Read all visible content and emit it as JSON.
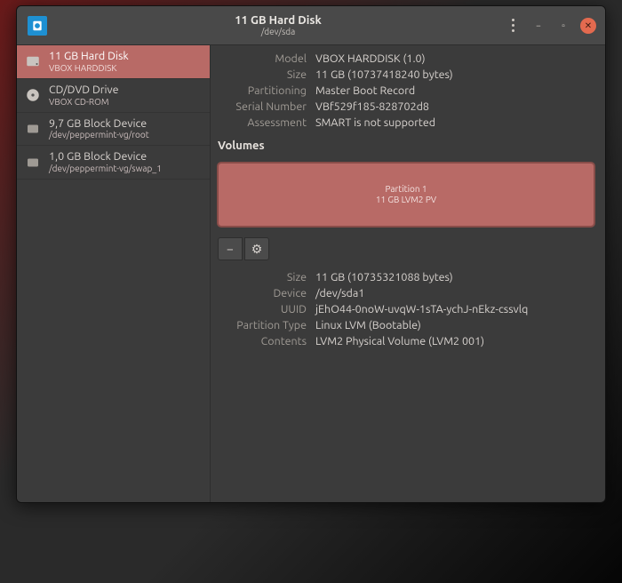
{
  "header": {
    "title": "11 GB Hard Disk",
    "subtitle": "/dev/sda"
  },
  "sidebar": {
    "items": [
      {
        "label": "11 GB Hard Disk",
        "sub": "VBOX HARDDISK",
        "icon": "hdd"
      },
      {
        "label": "CD/DVD Drive",
        "sub": "VBOX CD-ROM",
        "icon": "cd"
      },
      {
        "label": "9,7 GB Block Device",
        "sub": "/dev/peppermint-vg/root",
        "icon": "block"
      },
      {
        "label": "1,0 GB Block Device",
        "sub": "/dev/peppermint-vg/swap_1",
        "icon": "block"
      }
    ]
  },
  "info": {
    "model_label": "Model",
    "model_value": "VBOX HARDDISK (1.0)",
    "size_label": "Size",
    "size_value": "11 GB (10737418240 bytes)",
    "partitioning_label": "Partitioning",
    "partitioning_value": "Master Boot Record",
    "serial_label": "Serial Number",
    "serial_value": "VBf529f185-828702d8",
    "assessment_label": "Assessment",
    "assessment_value": "SMART is not supported"
  },
  "volumes_section_title": "Volumes",
  "volmap": {
    "line1": "Partition 1",
    "line2": "11 GB LVM2 PV"
  },
  "toolbar": {
    "minus": "−",
    "gear": "⚙"
  },
  "part": {
    "size_label": "Size",
    "size_value": "11 GB (10735321088 bytes)",
    "device_label": "Device",
    "device_value": "/dev/sda1",
    "uuid_label": "UUID",
    "uuid_value": "jEhO44-0noW-uvqW-1sTA-ychJ-nEkz-cssvlq",
    "type_label": "Partition Type",
    "type_value": "Linux LVM (Bootable)",
    "contents_label": "Contents",
    "contents_value": "LVM2 Physical Volume (LVM2 001)"
  }
}
